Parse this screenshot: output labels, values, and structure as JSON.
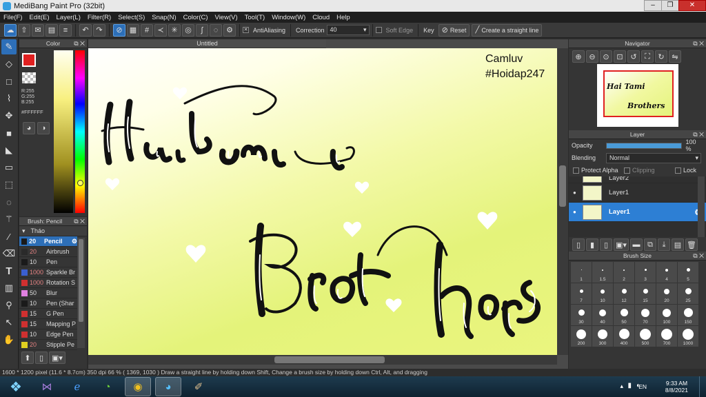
{
  "window": {
    "title": "MediBang Paint Pro (32bit)",
    "minimize": "–",
    "restore": "❐",
    "close": "✕"
  },
  "menu": [
    "File(F)",
    "Edit(E)",
    "Layer(L)",
    "Filter(R)",
    "Select(S)",
    "Snap(N)",
    "Color(C)",
    "View(V)",
    "Tool(T)",
    "Window(W)",
    "Cloud",
    "Help"
  ],
  "toolbar": {
    "antialiasing_label": "AntiAliasing",
    "correction_label": "Correction",
    "correction_value": "40",
    "soft_edge_label": "Soft Edge",
    "key_label": "Key",
    "reset_label": "Reset",
    "straight_line_label": "Create a straight line"
  },
  "color_panel": {
    "title": "Color",
    "r": "R:255",
    "g": "G:255",
    "b": "B:255",
    "hex": "#FFFFFF",
    "fg": "#e02020",
    "bg": "#ffffff"
  },
  "brush_panel": {
    "title": "Brush: Pencil",
    "group": "Tháo",
    "items": [
      {
        "size": "20",
        "name": "Pencil",
        "color": "#1a1a1a"
      },
      {
        "size": "20",
        "name": "Airbrush",
        "color": "#2a2a2a"
      },
      {
        "size": "10",
        "name": "Pen",
        "color": "#1a1a1a"
      },
      {
        "size": "1000",
        "name": "Sparkle Br",
        "color": "#3a5fd0"
      },
      {
        "size": "1000",
        "name": "Rotation S",
        "color": "#d03030"
      },
      {
        "size": "50",
        "name": "Blur",
        "color": "#e080e0"
      },
      {
        "size": "10",
        "name": "Pen (Shar",
        "color": "#1a1a1a"
      },
      {
        "size": "15",
        "name": "G Pen",
        "color": "#d03030"
      },
      {
        "size": "15",
        "name": "Mapping P",
        "color": "#d03030"
      },
      {
        "size": "10",
        "name": "Edge Pen",
        "color": "#d03030"
      },
      {
        "size": "20",
        "name": "Stipple Pe",
        "color": "#e0d020"
      }
    ]
  },
  "document": {
    "tab": "Untitled"
  },
  "canvas": {
    "watermark_line1": "Camluv",
    "watermark_line2": "#Hoidap247",
    "lettering_line1": "Hai Tami",
    "lettering_line2": "Brothers"
  },
  "navigator": {
    "title": "Navigator"
  },
  "layer_panel": {
    "title": "Layer",
    "opacity_label": "Opacity",
    "opacity_value": "100 %",
    "opacity": 1.0,
    "blending_label": "Blending",
    "blending_value": "Normal",
    "protect_alpha": "Protect Alpha",
    "clipping": "Clipping",
    "lock": "Lock",
    "layers": [
      {
        "name": "Layer2"
      },
      {
        "name": "Layer1"
      },
      {
        "name": "Layer1"
      }
    ]
  },
  "brush_size": {
    "title": "Brush Size",
    "sizes": [
      "1",
      "1.5",
      "2",
      "3",
      "4",
      "5",
      "7",
      "10",
      "12",
      "15",
      "20",
      "25",
      "30",
      "40",
      "50",
      "70",
      "100",
      "150",
      "200",
      "300",
      "400",
      "500",
      "700",
      "1000"
    ]
  },
  "status": {
    "text": "1600 * 1200 pixel   (11.6 * 8.7cm)   350 dpi   66 %   ( 1369, 1030 )   Draw a straight line by holding down Shift, Change a brush size by holding down Ctrl, Alt, and dragging"
  },
  "taskbar": {
    "lang": "EN",
    "time": "9:33 AM",
    "date": "8/8/2021"
  }
}
